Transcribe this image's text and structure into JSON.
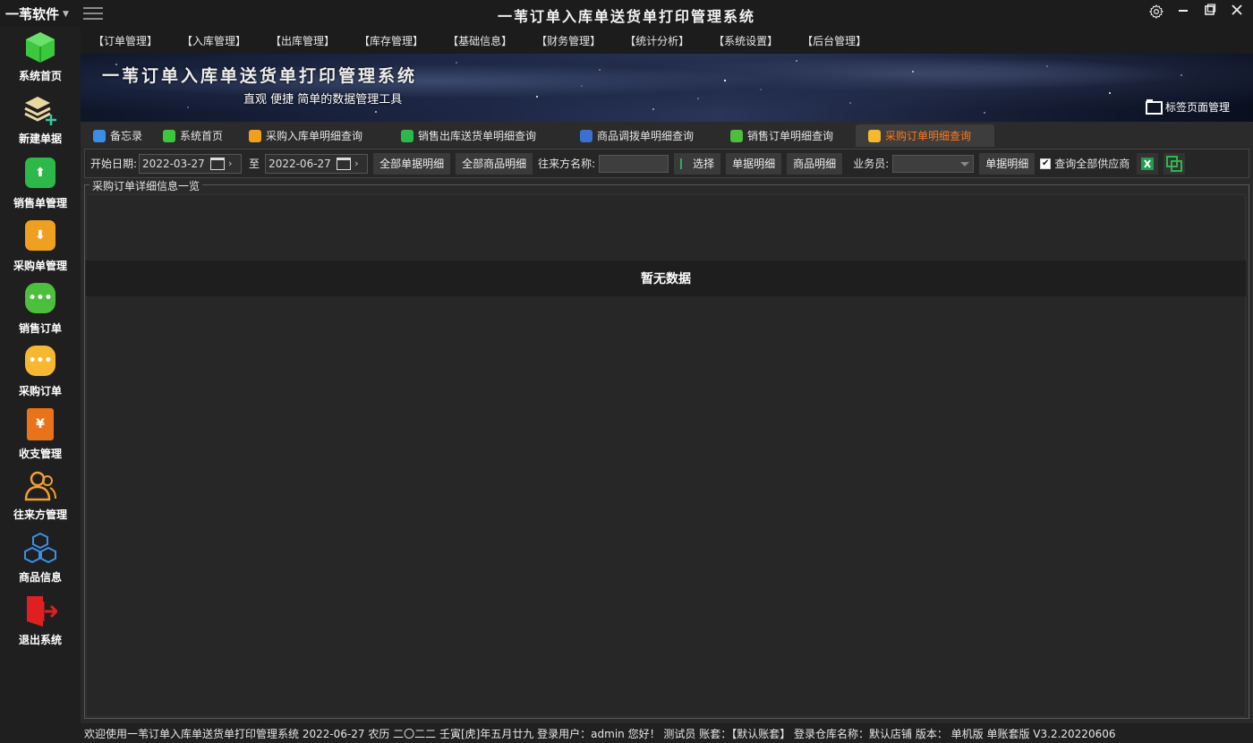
{
  "titlebar": {
    "brand": "一苇软件",
    "title": "一苇订单入库单送货单打印管理系统",
    "icons": [
      "gear-icon",
      "minimize-icon",
      "restore-icon",
      "close-icon"
    ]
  },
  "sidebar": {
    "items": [
      {
        "label": "系统首页",
        "icon": "green-cube-icon",
        "color": "#3cc83c"
      },
      {
        "label": "新建单据",
        "icon": "layers-add-icon",
        "color": "#e0c060"
      },
      {
        "label": "销售单管理",
        "icon": "green-box-icon",
        "color": "#2db84a"
      },
      {
        "label": "采购单管理",
        "icon": "orange-box-icon",
        "color": "#f0a020"
      },
      {
        "label": "销售订单",
        "icon": "green-chat-icon",
        "color": "#4cbf3c"
      },
      {
        "label": "采购订单",
        "icon": "yellow-chat-icon",
        "color": "#f5b830"
      },
      {
        "label": "收支管理",
        "icon": "yuan-icon",
        "color": "#e8731a"
      },
      {
        "label": "往来方管理",
        "icon": "users-icon",
        "color": "#f0a030"
      },
      {
        "label": "商品信息",
        "icon": "cubes-icon",
        "color": "#3a90e8"
      },
      {
        "label": "退出系统",
        "icon": "exit-icon",
        "color": "#e02020"
      }
    ]
  },
  "menubar": {
    "items": [
      "【订单管理】",
      "【入库管理】",
      "【出库管理】",
      "【库存管理】",
      "【基础信息】",
      "【财务管理】",
      "【统计分析】",
      "【系统设置】",
      "【后台管理】"
    ]
  },
  "banner": {
    "title": "一苇订单入库单送货单打印管理系统",
    "subtitle": "直观 便捷 简单的数据管理工具",
    "tab_manage": "标签页面管理"
  },
  "tabs": [
    {
      "label": "备忘录",
      "color": "#3a8ee6"
    },
    {
      "label": "系统首页",
      "color": "#3cc83c"
    },
    {
      "label": "采购入库单明细查询",
      "color": "#f0a020"
    },
    {
      "label": "销售出库送货单明细查询",
      "color": "#2db84a"
    },
    {
      "label": "商品调拨单明细查询",
      "color": "#3a70d0"
    },
    {
      "label": "销售订单明细查询",
      "color": "#4cbf3c"
    },
    {
      "label": "采购订单明细查询",
      "color": "#f5b830",
      "active": true
    }
  ],
  "toolbar": {
    "start_label": "开始日期:",
    "start_date": "2022-03-27",
    "to_label": "至",
    "end_date": "2022-06-27",
    "all_doc_detail": "全部单据明细",
    "all_goods_detail": "全部商品明细",
    "partner_label": "往来方名称:",
    "select_btn": "选择",
    "doc_detail_btn": "单据明细",
    "goods_detail_btn": "商品明细",
    "clerk_label": "业务员:",
    "doc_detail_btn2": "单据明细",
    "query_all_label": "查询全部供应商"
  },
  "group": {
    "legend": "采购订单详细信息一览",
    "empty_text": "暂无数据"
  },
  "statusbar": {
    "text": "欢迎使用一苇订单入库单送货单打印管理系统 2022-06-27 农历 二〇二二 壬寅[虎]年五月廿九 登录用户：admin 您好！ 测试员 账套：【默认账套】 登录仓库名称：默认店铺 版本： 单机版 单账套版 V3.2.20220606"
  }
}
